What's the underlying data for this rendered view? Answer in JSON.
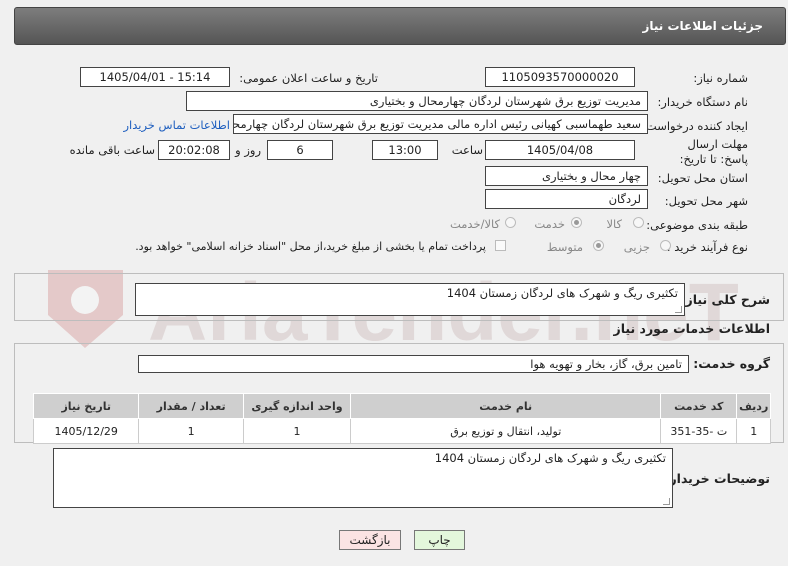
{
  "header": {
    "title": "جزئیات اطلاعات نیاز"
  },
  "form": {
    "need_number_label": "شماره نیاز:",
    "need_number": "1105093570000020",
    "announce_label": "تاریخ و ساعت اعلان عمومی:",
    "announce_value": "1405/04/01 - 15:14",
    "buyer_label": "نام دستگاه خریدار:",
    "buyer_value": "مدیریت توزیع برق شهرستان لردگان چهارمحال و بختیاری",
    "creator_label": "ایجاد کننده درخواست:",
    "creator_value": "سعید طهماسبی کهیانی رئیس اداره مالی مدیریت توزیع برق شهرستان لردگان چهارمحال و بختیاری",
    "contact_link": "اطلاعات تماس خریدار",
    "deadline_label": "مهلت ارسال پاسخ: تا تاریخ:",
    "deadline_date": "1405/04/08",
    "time_label": "ساعت",
    "deadline_time": "13:00",
    "days_value": "6",
    "days_label": "روز و",
    "remaining_time": "20:02:08",
    "remaining_label": "ساعت باقی مانده",
    "province_label": "استان محل تحویل:",
    "province_value": "چهار محال و بختیاری",
    "city_label": "شهر محل تحویل:",
    "city_value": "لردگان",
    "category_label": "طبقه بندی موضوعی:",
    "category_options": [
      "کالا",
      "خدمت",
      "کالا/خدمت"
    ],
    "process_label": "نوع فرآیند خرید :",
    "process_options": [
      "جزیی",
      "متوسط"
    ],
    "payment_text": "پرداخت تمام یا بخشی از مبلغ خرید،از محل \"اسناد خزانه اسلامی\" خواهد بود."
  },
  "summary": {
    "label": "شرح کلی نیاز:",
    "value": "تکثیری ریگ و شهرک های لردگان زمستان 1404"
  },
  "services": {
    "section_title": "اطلاعات خدمات مورد نیاز",
    "group_label": "گروه خدمت:",
    "group_value": "تامین برق، گاز، بخار و تهویه هوا",
    "columns": [
      "ردیف",
      "کد خدمت",
      "نام خدمت",
      "واحد اندازه گیری",
      "تعداد / مقدار",
      "تاریخ نیاز"
    ],
    "rows": [
      {
        "row": "1",
        "code": "ت -35-351",
        "name": "تولید، انتقال و توزیع برق",
        "unit": "1",
        "qty": "1",
        "date": "1405/12/29"
      }
    ]
  },
  "buyer_notes": {
    "label": "توضیحات خریدار:",
    "value": "تکثیری ریگ و شهرک های لردگان زمستان 1404"
  },
  "buttons": {
    "print": "چاپ",
    "back": "بازگشت"
  },
  "watermark": "AriaTender.neT",
  "colors": {
    "header": "#666666",
    "link": "#1f5fbf",
    "print_button": "#e3f7dc",
    "back_button": "#fbe3e3",
    "watermark": "#d9c8c8"
  }
}
